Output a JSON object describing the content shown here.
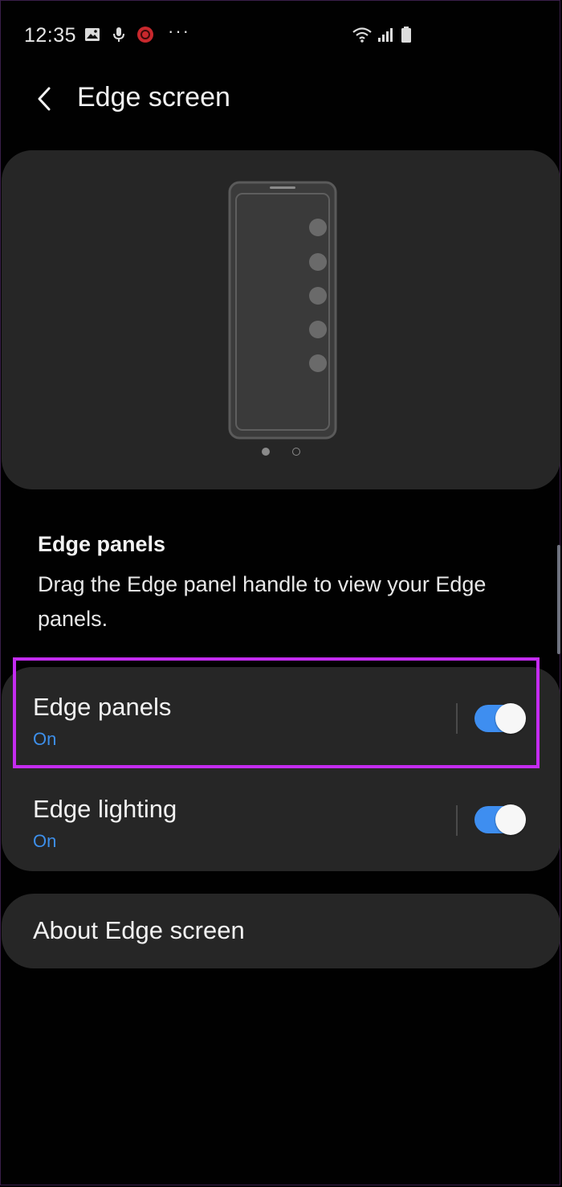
{
  "status_bar": {
    "time": "12:35",
    "more": "···",
    "icons": [
      "gallery-icon",
      "mic-icon",
      "app-notification-icon",
      "wifi-icon",
      "signal-icon",
      "battery-icon"
    ]
  },
  "header": {
    "title": "Edge screen",
    "back_icon": "chevron-left-icon"
  },
  "preview": {
    "page_count": 2,
    "active_page": 1
  },
  "description": {
    "title": "Edge panels",
    "text": "Drag the Edge panel handle to view your Edge panels."
  },
  "settings": [
    {
      "title": "Edge panels",
      "status": "On",
      "enabled": true,
      "highlighted": true
    },
    {
      "title": "Edge lighting",
      "status": "On",
      "enabled": true,
      "highlighted": false
    }
  ],
  "about": {
    "label": "About Edge screen"
  },
  "colors": {
    "background": "#010101",
    "card": "#262626",
    "accent": "#3e8ef0",
    "status_text": "#3d8fea",
    "highlight": "#c42cf0"
  }
}
